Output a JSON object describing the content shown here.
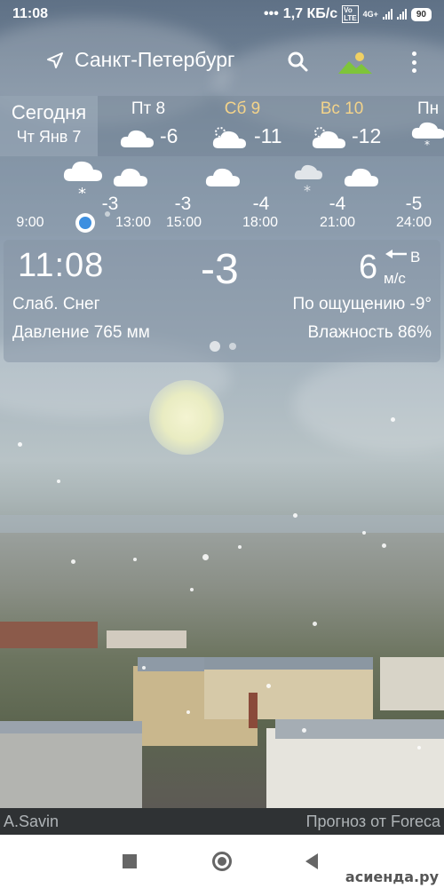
{
  "status_bar": {
    "time": "11:08",
    "net_speed": "1,7 КБ/с",
    "net_type": "4G+",
    "battery": "90"
  },
  "header": {
    "city": "Санкт-Петербург",
    "location_icon": "location-arrow-icon",
    "search_icon": "search-icon",
    "background_icon": "landscape-icon",
    "menu_icon": "more-vert-icon"
  },
  "daily": {
    "today_label": "Сегодня",
    "today_date": "Чт Янв 7",
    "days": [
      {
        "name": "Пт 8",
        "temp": "-6",
        "icon": "cloud-icon",
        "weekend": false
      },
      {
        "name": "Сб 9",
        "temp": "-11",
        "icon": "sun-cloud-icon",
        "weekend": true
      },
      {
        "name": "Вс 10",
        "temp": "-12",
        "icon": "sun-cloud-icon",
        "weekend": true
      },
      {
        "name": "Пн",
        "temp": "",
        "icon": "snow-cloud-icon",
        "weekend": false
      }
    ]
  },
  "hourly": {
    "times": [
      "9:00",
      "13:00",
      "15:00",
      "18:00",
      "21:00",
      "24:00"
    ],
    "temps": [
      "-3",
      "-3",
      "-4",
      "-4",
      "-5"
    ]
  },
  "current": {
    "time": "11:08",
    "temp": "-3",
    "wind_speed": "6",
    "wind_dir": "В",
    "wind_unit": "м/с",
    "condition": "Слаб. Снег",
    "pressure": "Давление 765 мм",
    "feels_like": "По ощущению -9°",
    "humidity": "Влажность 86%"
  },
  "credits": {
    "photo_author": "A.Savin",
    "forecast_source": "Прогноз от Foreca"
  },
  "watermark": "асиенда.ру",
  "colors": {
    "weekend": "#f3d38a",
    "accent_marker": "#3d8fe0",
    "sun_icon": "#f0d064",
    "landscape_icon": "#7ec43a"
  }
}
